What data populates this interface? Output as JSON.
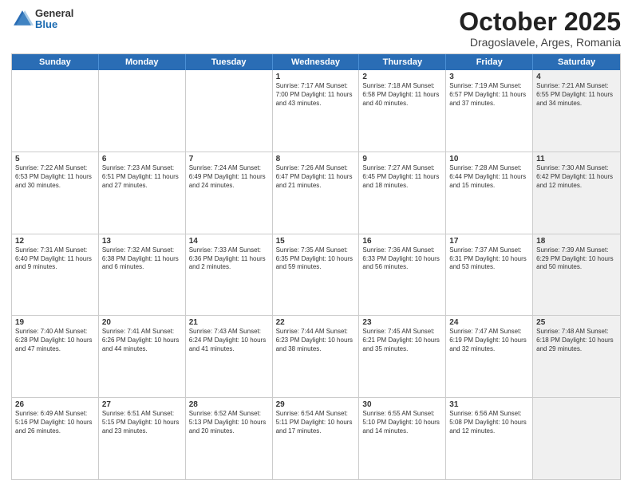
{
  "logo": {
    "general": "General",
    "blue": "Blue"
  },
  "title": "October 2025",
  "subtitle": "Dragoslavele, Arges, Romania",
  "days": [
    "Sunday",
    "Monday",
    "Tuesday",
    "Wednesday",
    "Thursday",
    "Friday",
    "Saturday"
  ],
  "weeks": [
    [
      {
        "day": "",
        "info": "",
        "shaded": false
      },
      {
        "day": "",
        "info": "",
        "shaded": false
      },
      {
        "day": "",
        "info": "",
        "shaded": false
      },
      {
        "day": "1",
        "info": "Sunrise: 7:17 AM\nSunset: 7:00 PM\nDaylight: 11 hours and 43 minutes.",
        "shaded": false
      },
      {
        "day": "2",
        "info": "Sunrise: 7:18 AM\nSunset: 6:58 PM\nDaylight: 11 hours and 40 minutes.",
        "shaded": false
      },
      {
        "day": "3",
        "info": "Sunrise: 7:19 AM\nSunset: 6:57 PM\nDaylight: 11 hours and 37 minutes.",
        "shaded": false
      },
      {
        "day": "4",
        "info": "Sunrise: 7:21 AM\nSunset: 6:55 PM\nDaylight: 11 hours and 34 minutes.",
        "shaded": true
      }
    ],
    [
      {
        "day": "5",
        "info": "Sunrise: 7:22 AM\nSunset: 6:53 PM\nDaylight: 11 hours and 30 minutes.",
        "shaded": false
      },
      {
        "day": "6",
        "info": "Sunrise: 7:23 AM\nSunset: 6:51 PM\nDaylight: 11 hours and 27 minutes.",
        "shaded": false
      },
      {
        "day": "7",
        "info": "Sunrise: 7:24 AM\nSunset: 6:49 PM\nDaylight: 11 hours and 24 minutes.",
        "shaded": false
      },
      {
        "day": "8",
        "info": "Sunrise: 7:26 AM\nSunset: 6:47 PM\nDaylight: 11 hours and 21 minutes.",
        "shaded": false
      },
      {
        "day": "9",
        "info": "Sunrise: 7:27 AM\nSunset: 6:45 PM\nDaylight: 11 hours and 18 minutes.",
        "shaded": false
      },
      {
        "day": "10",
        "info": "Sunrise: 7:28 AM\nSunset: 6:44 PM\nDaylight: 11 hours and 15 minutes.",
        "shaded": false
      },
      {
        "day": "11",
        "info": "Sunrise: 7:30 AM\nSunset: 6:42 PM\nDaylight: 11 hours and 12 minutes.",
        "shaded": true
      }
    ],
    [
      {
        "day": "12",
        "info": "Sunrise: 7:31 AM\nSunset: 6:40 PM\nDaylight: 11 hours and 9 minutes.",
        "shaded": false
      },
      {
        "day": "13",
        "info": "Sunrise: 7:32 AM\nSunset: 6:38 PM\nDaylight: 11 hours and 6 minutes.",
        "shaded": false
      },
      {
        "day": "14",
        "info": "Sunrise: 7:33 AM\nSunset: 6:36 PM\nDaylight: 11 hours and 2 minutes.",
        "shaded": false
      },
      {
        "day": "15",
        "info": "Sunrise: 7:35 AM\nSunset: 6:35 PM\nDaylight: 10 hours and 59 minutes.",
        "shaded": false
      },
      {
        "day": "16",
        "info": "Sunrise: 7:36 AM\nSunset: 6:33 PM\nDaylight: 10 hours and 56 minutes.",
        "shaded": false
      },
      {
        "day": "17",
        "info": "Sunrise: 7:37 AM\nSunset: 6:31 PM\nDaylight: 10 hours and 53 minutes.",
        "shaded": false
      },
      {
        "day": "18",
        "info": "Sunrise: 7:39 AM\nSunset: 6:29 PM\nDaylight: 10 hours and 50 minutes.",
        "shaded": true
      }
    ],
    [
      {
        "day": "19",
        "info": "Sunrise: 7:40 AM\nSunset: 6:28 PM\nDaylight: 10 hours and 47 minutes.",
        "shaded": false
      },
      {
        "day": "20",
        "info": "Sunrise: 7:41 AM\nSunset: 6:26 PM\nDaylight: 10 hours and 44 minutes.",
        "shaded": false
      },
      {
        "day": "21",
        "info": "Sunrise: 7:43 AM\nSunset: 6:24 PM\nDaylight: 10 hours and 41 minutes.",
        "shaded": false
      },
      {
        "day": "22",
        "info": "Sunrise: 7:44 AM\nSunset: 6:23 PM\nDaylight: 10 hours and 38 minutes.",
        "shaded": false
      },
      {
        "day": "23",
        "info": "Sunrise: 7:45 AM\nSunset: 6:21 PM\nDaylight: 10 hours and 35 minutes.",
        "shaded": false
      },
      {
        "day": "24",
        "info": "Sunrise: 7:47 AM\nSunset: 6:19 PM\nDaylight: 10 hours and 32 minutes.",
        "shaded": false
      },
      {
        "day": "25",
        "info": "Sunrise: 7:48 AM\nSunset: 6:18 PM\nDaylight: 10 hours and 29 minutes.",
        "shaded": true
      }
    ],
    [
      {
        "day": "26",
        "info": "Sunrise: 6:49 AM\nSunset: 5:16 PM\nDaylight: 10 hours and 26 minutes.",
        "shaded": false
      },
      {
        "day": "27",
        "info": "Sunrise: 6:51 AM\nSunset: 5:15 PM\nDaylight: 10 hours and 23 minutes.",
        "shaded": false
      },
      {
        "day": "28",
        "info": "Sunrise: 6:52 AM\nSunset: 5:13 PM\nDaylight: 10 hours and 20 minutes.",
        "shaded": false
      },
      {
        "day": "29",
        "info": "Sunrise: 6:54 AM\nSunset: 5:11 PM\nDaylight: 10 hours and 17 minutes.",
        "shaded": false
      },
      {
        "day": "30",
        "info": "Sunrise: 6:55 AM\nSunset: 5:10 PM\nDaylight: 10 hours and 14 minutes.",
        "shaded": false
      },
      {
        "day": "31",
        "info": "Sunrise: 6:56 AM\nSunset: 5:08 PM\nDaylight: 10 hours and 12 minutes.",
        "shaded": false
      },
      {
        "day": "",
        "info": "",
        "shaded": true
      }
    ]
  ]
}
